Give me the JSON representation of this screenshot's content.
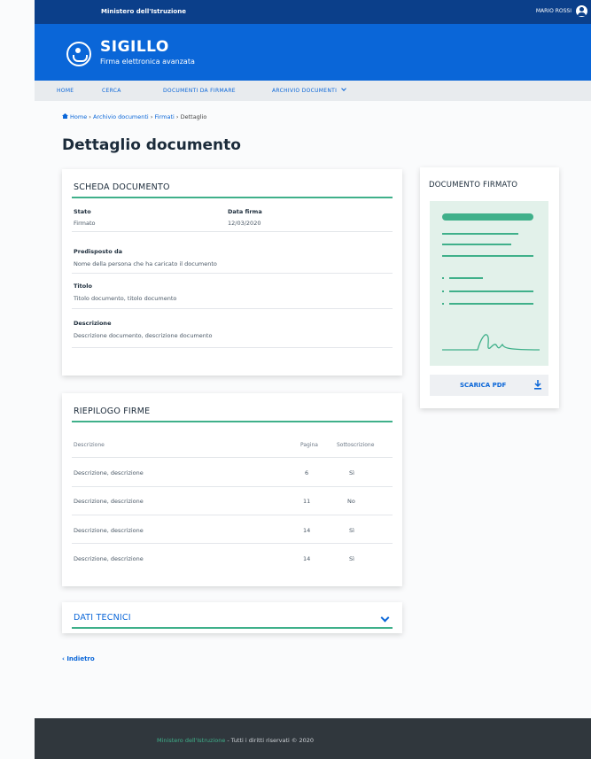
{
  "topbar": {
    "ministry": "Ministero dell'Istruzione",
    "user": "MARIO ROSSI",
    "user_icon": "user-circle-icon"
  },
  "header": {
    "app_name": "SIGILLO",
    "app_subtitle": "Firma elettronica avanzata",
    "logo_icon": "seal-logo-icon"
  },
  "nav": {
    "items": [
      {
        "label": "HOME"
      },
      {
        "label": "CERCA"
      },
      {
        "label": "DOCUMENTI DA FIRMARE"
      },
      {
        "label": "ARCHIVIO DOCUMENTI"
      }
    ]
  },
  "breadcrumb": {
    "items": [
      "Home",
      "Archivio documenti",
      "Firmati",
      "Dettaglio"
    ],
    "separator": "›"
  },
  "page_title": "Dettaglio documento",
  "scheda": {
    "title": "SCHEDA DOCUMENTO",
    "stato_label": "Stato",
    "stato_value": "Firmato",
    "data_label": "Data firma",
    "data_value": "12/03/2020",
    "predisposto_label": "Predisposto da",
    "predisposto_value": "Nome della persona che ha caricato il documento",
    "titolo_label": "Titolo",
    "titolo_value": "Titolo documento, titolo documento",
    "descrizione_label": "Descrizione",
    "descrizione_value": "Descrizione documento, descrizione documento"
  },
  "riepilogo": {
    "title": "RIEPILOGO FIRME",
    "columns": [
      "Descrizione",
      "Pagina",
      "Sottoscrizione"
    ],
    "rows": [
      {
        "desc": "Descrizione, descrizione",
        "page": "6",
        "sign": "Sì"
      },
      {
        "desc": "Descrizione, descrizione",
        "page": "11",
        "sign": "No"
      },
      {
        "desc": "Descrizione, descrizione",
        "page": "14",
        "sign": "Sì"
      },
      {
        "desc": "Descrizione, descrizione",
        "page": "14",
        "sign": "Sì"
      }
    ]
  },
  "dati_tecnici": {
    "title": "DATI TECNICI"
  },
  "firmato": {
    "title": "DOCUMENTO FIRMATO",
    "download_label": "SCARICA PDF",
    "download_icon": "download-icon"
  },
  "back_label": "‹ Indietro",
  "footer": {
    "ministry": "Ministero dell'Istruzione",
    "rights": " - Tutti i diritti riservati © 2020"
  },
  "colors": {
    "topbar": "#0b3f8a",
    "header": "#0a66d8",
    "accent": "#3fb08a",
    "footer": "#30373d"
  }
}
